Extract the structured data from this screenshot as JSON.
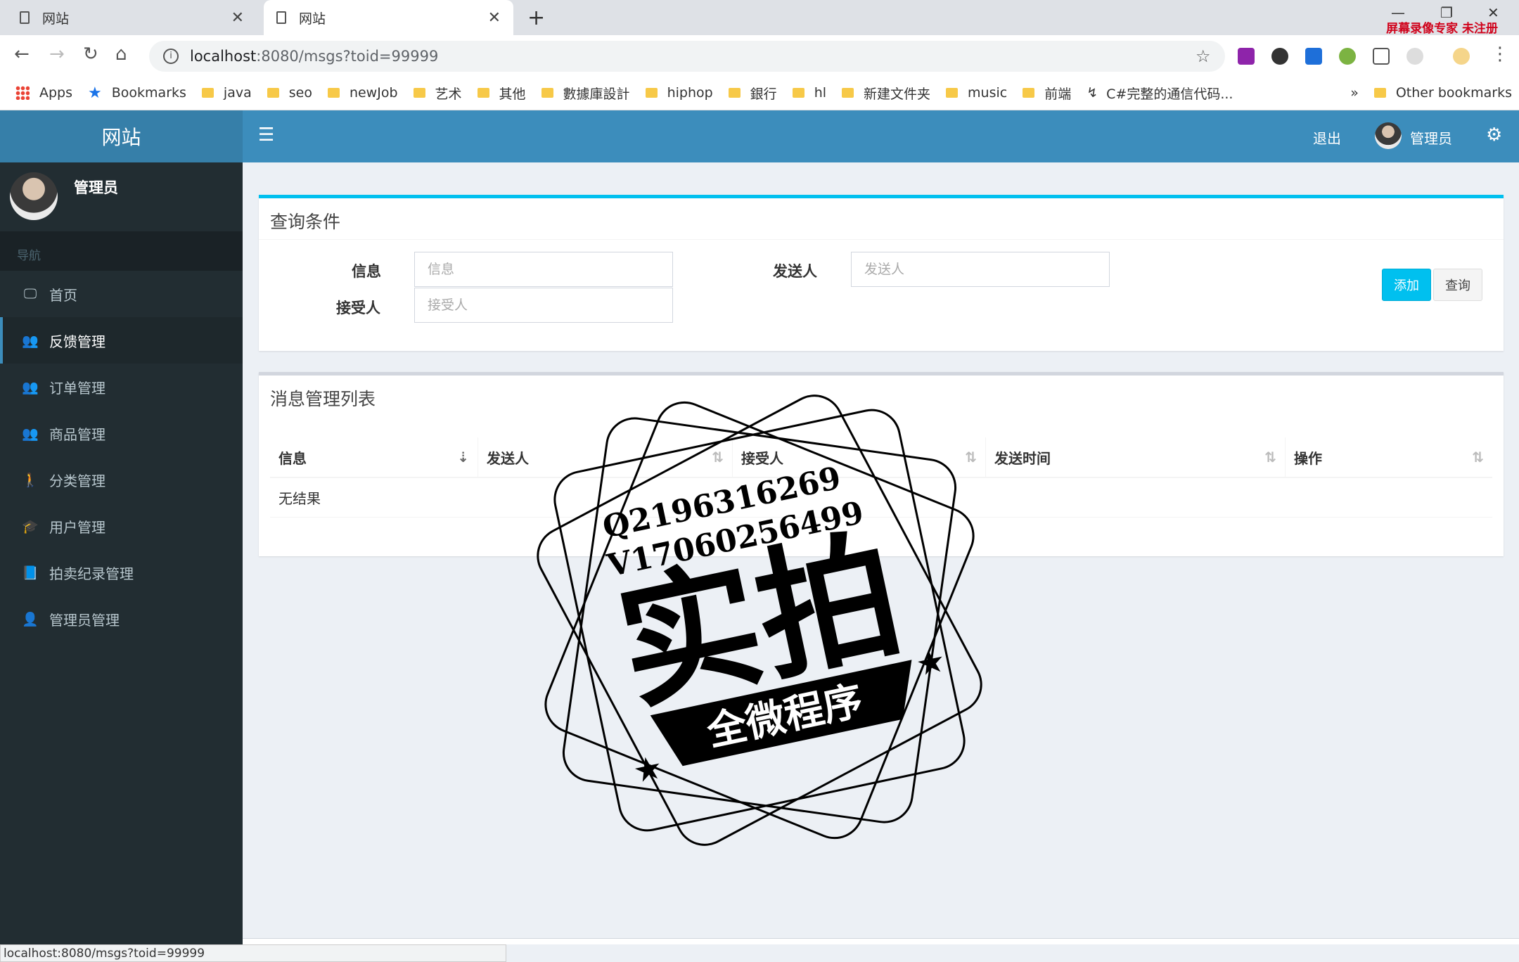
{
  "browser": {
    "tabs": [
      {
        "title": "网站",
        "active": false
      },
      {
        "title": "网站",
        "active": true
      }
    ],
    "recorder_label": "屏幕录像专家 未注册",
    "url_host": "localhost",
    "url_path": ":8080/msgs?toid=99999",
    "bookmarks": [
      "Apps",
      "Bookmarks",
      "java",
      "seo",
      "newJob",
      "艺术",
      "其他",
      "數據庫設計",
      "hiphop",
      "銀行",
      "hl",
      "新建文件夹",
      "music",
      "前端",
      "C#完整的通信代码...",
      "»",
      "Other bookmarks"
    ],
    "status_url": "localhost:8080/msgs?toid=99999"
  },
  "app": {
    "logo": "网站",
    "user_name": "管理员",
    "nav_header": "导航",
    "menu": [
      {
        "label": "首页",
        "icon": "monitor-icon"
      },
      {
        "label": "反馈管理",
        "icon": "users-icon"
      },
      {
        "label": "订单管理",
        "icon": "users-icon"
      },
      {
        "label": "商品管理",
        "icon": "users-icon"
      },
      {
        "label": "分类管理",
        "icon": "child-icon"
      },
      {
        "label": "用户管理",
        "icon": "graduation-cap-icon"
      },
      {
        "label": "拍卖纪录管理",
        "icon": "book-icon"
      },
      {
        "label": "管理员管理",
        "icon": "user-icon"
      }
    ],
    "active_menu": "反馈管理",
    "header": {
      "logout": "退出",
      "user": "管理员"
    },
    "query": {
      "title": "查询条件",
      "info_label": "信息",
      "info_placeholder": "信息",
      "sender_label": "发送人",
      "sender_placeholder": "发送人",
      "receiver_label": "接受人",
      "receiver_placeholder": "接受人",
      "add_button": "添加",
      "query_button": "查询"
    },
    "list": {
      "title": "消息管理列表",
      "columns": [
        "信息",
        "发送人",
        "接受人",
        "发送时间",
        "操作"
      ],
      "empty_text": "无结果"
    }
  },
  "watermark": {
    "line1": "Q2196316269",
    "line2": "V17060256499",
    "main": "实拍",
    "ribbon": "全微程序"
  },
  "colors": {
    "accent": "#3c8dbc",
    "sidebar": "#222d32",
    "info_button": "#00c0ef"
  }
}
